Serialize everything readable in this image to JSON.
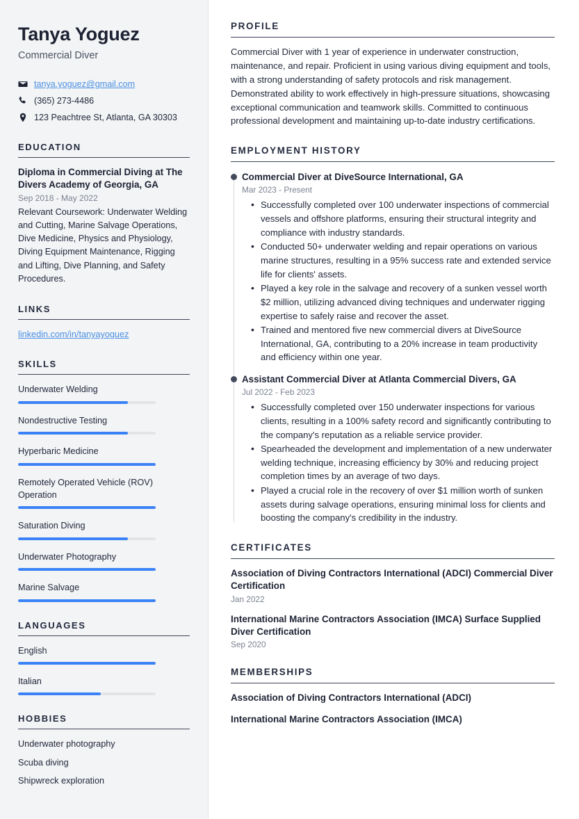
{
  "theme": {
    "sidebar_background": "#f3f4f6",
    "heading_color": "#232a3d",
    "text_color": "#22283a",
    "muted_color": "#7b8190",
    "accent_color": "#3b82f6",
    "link_color": "#4a90e2",
    "timeline_dot_color": "#424a5c"
  },
  "sidebar": {
    "name": "Tanya Yoguez",
    "job_title": "Commercial Diver",
    "contact": [
      {
        "icon": "envelope-icon",
        "text": "tanya.yoguez@gmail.com",
        "is_link": true
      },
      {
        "icon": "phone-icon",
        "text": "(365) 273-4486",
        "is_link": false
      },
      {
        "icon": "location-pin-icon",
        "text": "123 Peachtree St, Atlanta, GA 30303",
        "is_link": false
      }
    ],
    "education": {
      "heading": "EDUCATION",
      "title": "Diploma in Commercial Diving at The Divers Academy of Georgia, GA",
      "date": "Sep 2018 - May 2022",
      "description": "Relevant Coursework: Underwater Welding and Cutting, Marine Salvage Operations, Dive Medicine, Physics and Physiology, Diving Equipment Maintenance, Rigging and Lifting, Dive Planning, and Safety Procedures."
    },
    "links": {
      "heading": "LINKS",
      "items": [
        {
          "label": "linkedin.com/in/tanyayoguez"
        }
      ]
    },
    "skills": {
      "heading": "SKILLS",
      "items": [
        {
          "label": "Underwater Welding",
          "level": 80
        },
        {
          "label": "Nondestructive Testing",
          "level": 80
        },
        {
          "label": "Hyperbaric Medicine",
          "level": 100
        },
        {
          "label": "Remotely Operated Vehicle (ROV) Operation",
          "level": 100
        },
        {
          "label": "Saturation Diving",
          "level": 80
        },
        {
          "label": "Underwater Photography",
          "level": 100
        },
        {
          "label": "Marine Salvage",
          "level": 100
        }
      ]
    },
    "languages": {
      "heading": "LANGUAGES",
      "items": [
        {
          "label": "English",
          "level": 100
        },
        {
          "label": "Italian",
          "level": 60
        }
      ]
    },
    "hobbies": {
      "heading": "HOBBIES",
      "items": [
        {
          "label": "Underwater photography"
        },
        {
          "label": "Scuba diving"
        },
        {
          "label": "Shipwreck exploration"
        }
      ]
    }
  },
  "main": {
    "profile": {
      "heading": "PROFILE",
      "text": "Commercial Diver with 1 year of experience in underwater construction, maintenance, and repair. Proficient in using various diving equipment and tools, with a strong understanding of safety protocols and risk management. Demonstrated ability to work effectively in high-pressure situations, showcasing exceptional communication and teamwork skills. Committed to continuous professional development and maintaining up-to-date industry certifications."
    },
    "employment": {
      "heading": "EMPLOYMENT HISTORY",
      "jobs": [
        {
          "role": "Commercial Diver at DiveSource International, GA",
          "date": "Mar 2023 - Present",
          "bullets": [
            "Successfully completed over 100 underwater inspections of commercial vessels and offshore platforms, ensuring their structural integrity and compliance with industry standards.",
            "Conducted 50+ underwater welding and repair operations on various marine structures, resulting in a 95% success rate and extended service life for clients' assets.",
            "Played a key role in the salvage and recovery of a sunken vessel worth $2 million, utilizing advanced diving techniques and underwater rigging expertise to safely raise and recover the asset.",
            "Trained and mentored five new commercial divers at DiveSource International, GA, contributing to a 20% increase in team productivity and efficiency within one year."
          ]
        },
        {
          "role": "Assistant Commercial Diver at Atlanta Commercial Divers, GA",
          "date": "Jul 2022 - Feb 2023",
          "bullets": [
            "Successfully completed over 150 underwater inspections for various clients, resulting in a 100% safety record and significantly contributing to the company's reputation as a reliable service provider.",
            "Spearheaded the development and implementation of a new underwater welding technique, increasing efficiency by 30% and reducing project completion times by an average of two days.",
            "Played a crucial role in the recovery of over $1 million worth of sunken assets during salvage operations, ensuring minimal loss for clients and boosting the company's credibility in the industry."
          ]
        }
      ]
    },
    "certificates": {
      "heading": "CERTIFICATES",
      "items": [
        {
          "name": "Association of Diving Contractors International (ADCI) Commercial Diver Certification",
          "date": "Jan 2022"
        },
        {
          "name": "International Marine Contractors Association (IMCA) Surface Supplied Diver Certification",
          "date": "Sep 2020"
        }
      ]
    },
    "memberships": {
      "heading": "MEMBERSHIPS",
      "items": [
        {
          "name": "Association of Diving Contractors International (ADCI)"
        },
        {
          "name": "International Marine Contractors Association (IMCA)"
        }
      ]
    }
  }
}
